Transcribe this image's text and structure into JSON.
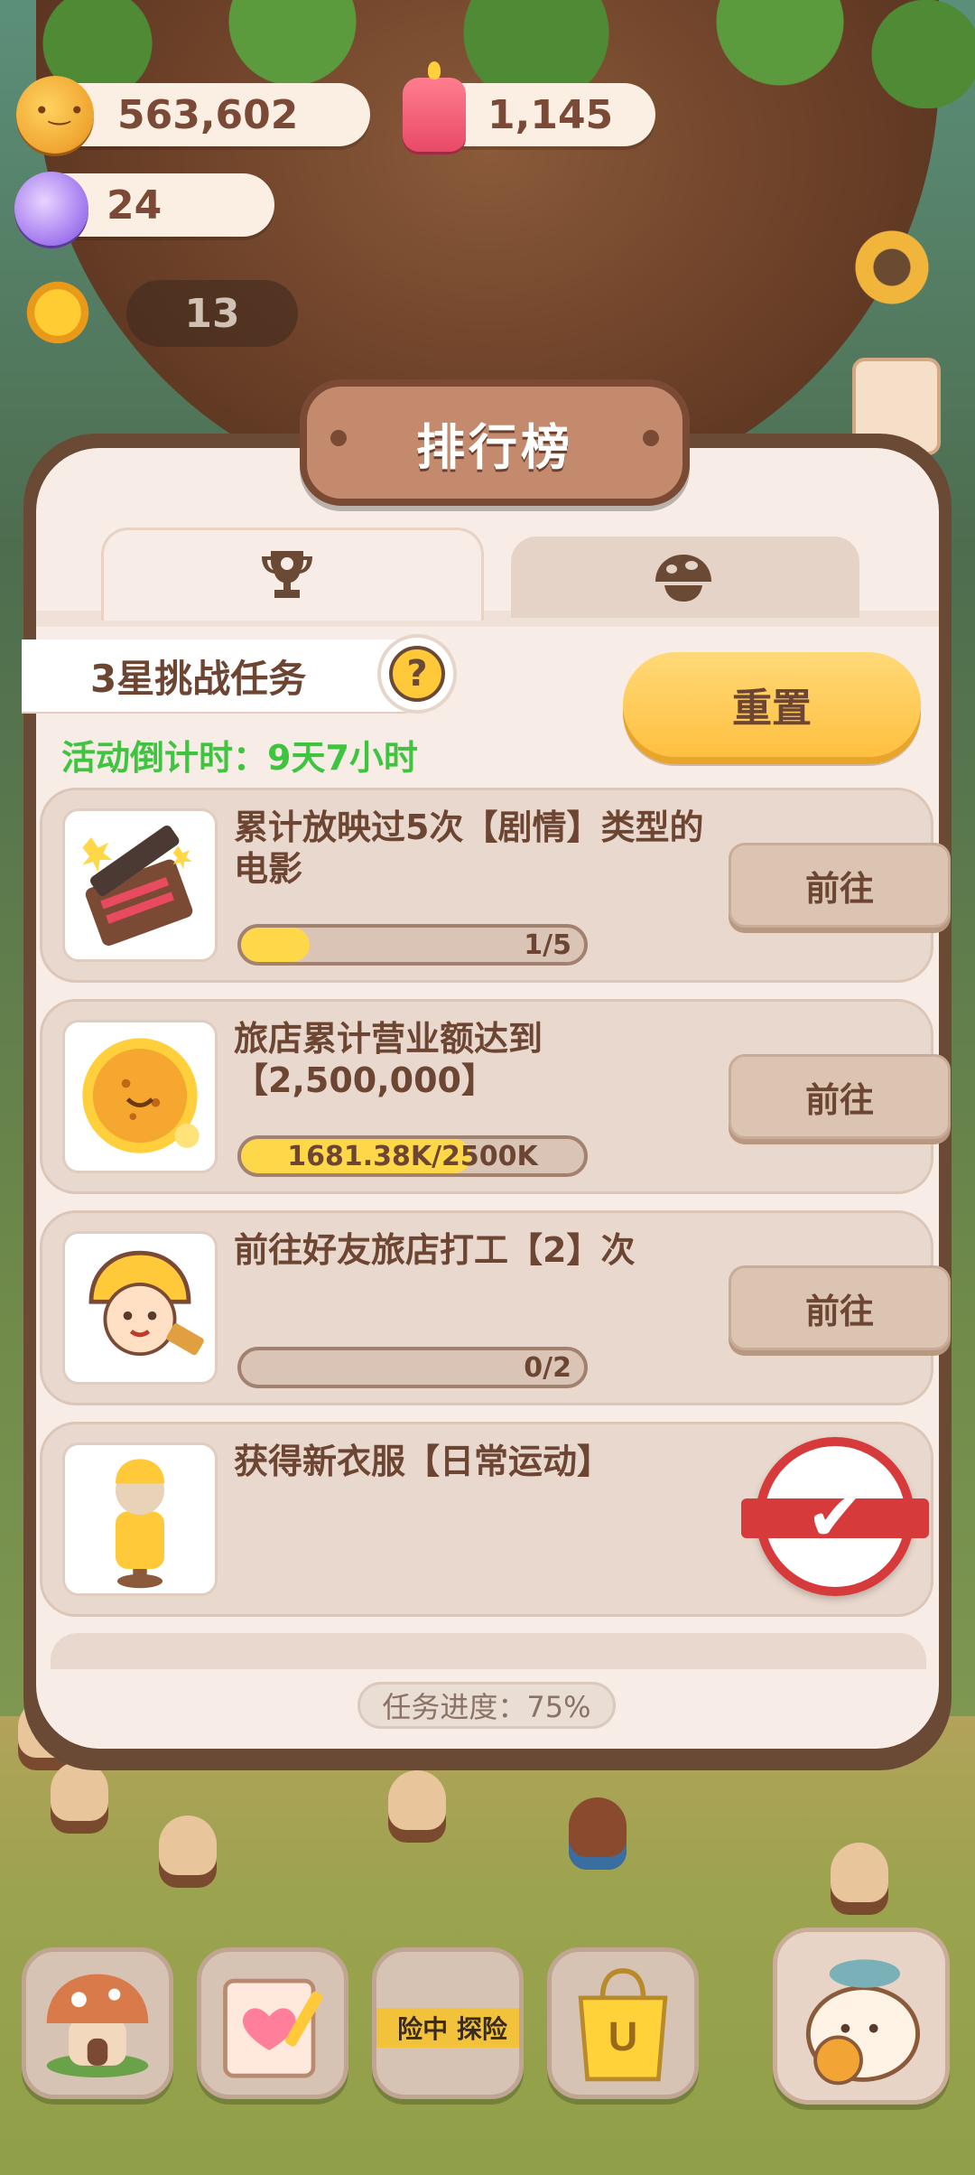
{
  "currency": {
    "cookies": "563,602",
    "candles": "1,145",
    "gems": "24"
  },
  "level": "13",
  "panel": {
    "title": "排行榜",
    "tabs": [
      {
        "icon": "trophy-icon",
        "active": true
      },
      {
        "icon": "mushroom-icon",
        "active": false
      }
    ],
    "task_name": "3星挑战任务",
    "help_symbol": "?",
    "countdown": "活动倒计时：9天7小时",
    "reset_label": "重置",
    "tasks": [
      {
        "desc": "累计放映过5次【剧情】类型的电影",
        "progress_text": "1/5",
        "progress": 0.2,
        "action": "前往",
        "icon": "clapperboard-icon",
        "done": false
      },
      {
        "desc": "旅店累计营业额达到【2,500,000】",
        "progress_text": "1681.38K/2500K",
        "progress": 0.672,
        "action": "前往",
        "icon": "cookie-coin-icon",
        "done": false
      },
      {
        "desc": "前往好友旅店打工【2】次",
        "progress_text": "0/2",
        "progress": 0,
        "action": "前往",
        "icon": "worker-icon",
        "done": false
      },
      {
        "desc": "获得新衣服【日常运动】",
        "progress_text": "",
        "progress": 1,
        "action": "",
        "icon": "outfit-icon",
        "done": true
      }
    ],
    "overall_progress": "任务进度：75%"
  },
  "bottom_nav": {
    "banner_text": "险中 探险"
  },
  "colors": {
    "accent": "#ffc93a",
    "text_brown": "#6d4533",
    "countdown_green": "#3fc43f",
    "stamp_red": "#d63a3a"
  }
}
